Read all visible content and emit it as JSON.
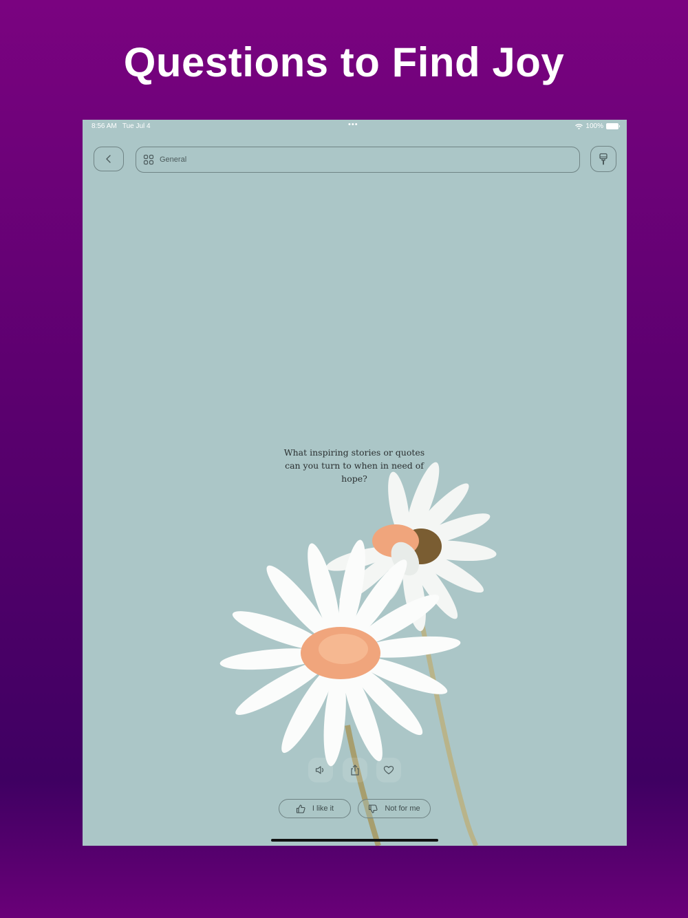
{
  "headline": "Questions to Find Joy",
  "status_bar": {
    "time": "8:56 AM",
    "date": "Tue Jul 4",
    "dots": "•••",
    "battery": "100%"
  },
  "toolbar": {
    "category": "General"
  },
  "card": {
    "question": "What inspiring stories or quotes can you turn to when in need of hope?"
  },
  "feedback": {
    "like_label": "I like it",
    "dislike_label": "Not for me"
  },
  "colors": {
    "background_top": "#7a0380",
    "background_bottom": "#3f0062",
    "screen_bg": "#abc6c7",
    "petal": "#ffffff",
    "flower_center": "#f0a57c"
  }
}
